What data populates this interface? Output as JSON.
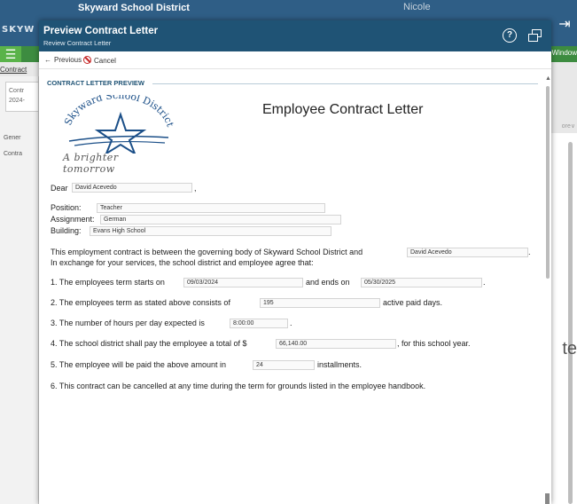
{
  "background": {
    "district_name": "Skyward School District",
    "logo_text": "SKYW",
    "user_name": "Nicole",
    "window_link": "Window",
    "breadcrumb": "Contract",
    "card_lines": [
      "Contr",
      "2024-"
    ],
    "tabs": [
      "Gener",
      "Contra"
    ],
    "more_label": "ore",
    "partial_text": "te"
  },
  "modal": {
    "title": "Preview Contract Letter",
    "subtitle": "Review Contract Letter",
    "toolbar": {
      "previous_label": "Previous",
      "cancel_label": "Cancel"
    },
    "section_label": "CONTRACT LETTER PREVIEW"
  },
  "letter": {
    "logo_text": "Skyward School District",
    "tagline": "A brighter tomorrow",
    "title": "Employee Contract Letter",
    "dear_label": "Dear",
    "employee_name": "David Acevedo",
    "position_label": "Position:",
    "position_value": "Teacher",
    "assignment_label": "Assignment:",
    "assignment_value": "German",
    "building_label": "Building:",
    "building_value": "Evans High School",
    "intro_line1": "This employment contract is between the governing body of Skyward School District and",
    "intro_line2": "In exchange for your services, the school district and employee agree that:",
    "item1_text": "1. The employees term starts on",
    "start_date": "09/03/2024",
    "item1_mid": "and ends on",
    "end_date": "05/30/2025",
    "item2_text": "2. The employees term as stated above consists of",
    "paid_days": "195",
    "item2_end": "active paid days.",
    "item3_text": "3. The number of hours per day expected is",
    "hours_per_day": "8:00:00",
    "item4_text": "4. The school district shall pay the employee a total of $",
    "total_pay": "66,140.00",
    "item4_end": ", for this school year.",
    "item5_text": "5. The employee will be paid the above amount in",
    "installments": "24",
    "item5_end": "installments.",
    "item6_text": "6. This contract can be cancelled at any time during the term for grounds listed in the employee handbook.",
    "comma": ",",
    "period": "."
  }
}
